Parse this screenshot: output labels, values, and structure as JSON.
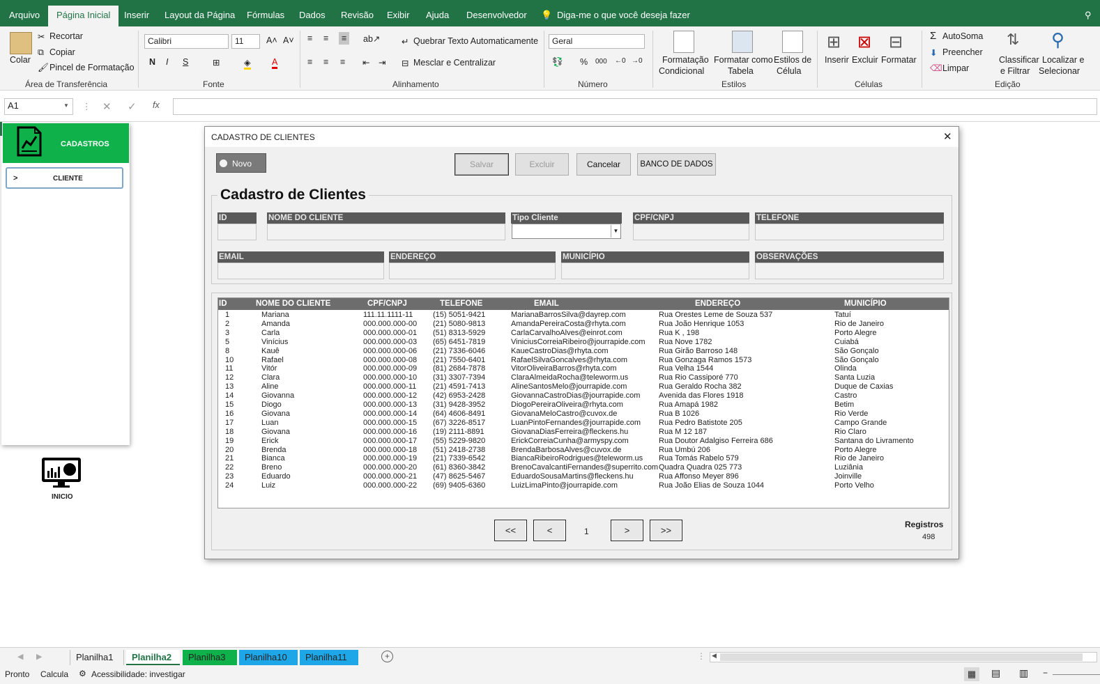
{
  "ribbon_tabs": [
    "Arquivo",
    "Página Inicial",
    "Inserir",
    "Layout da Página",
    "Fórmulas",
    "Dados",
    "Revisão",
    "Exibir",
    "Ajuda",
    "Desenvolvedor"
  ],
  "tell_me": "Diga-me o que você deseja fazer",
  "clipboard": {
    "paste": "Colar",
    "cut": "Recortar",
    "copy": "Copiar",
    "format_painter": "Pincel de Formatação",
    "group": "Área de Transferência"
  },
  "font": {
    "name": "Calibri",
    "size": "11",
    "bold": "N",
    "italic": "I",
    "underline": "S",
    "group": "Fonte"
  },
  "alignment": {
    "wrap": "Quebrar Texto Automaticamente",
    "merge": "Mesclar e Centralizar",
    "group": "Alinhamento"
  },
  "number": {
    "format": "Geral",
    "percent": "%",
    "thousands": "000",
    "group": "Número"
  },
  "styles": {
    "cond": "Formatação",
    "cond2": "Condicional",
    "table": "Formatar como",
    "table2": "Tabela",
    "cell": "Estilos de",
    "cell2": "Célula",
    "group": "Estilos"
  },
  "cells": {
    "insert": "Inserir",
    "delete": "Excluir",
    "format": "Formatar",
    "group": "Células"
  },
  "editing": {
    "autosum": "AutoSoma",
    "fill": "Preencher",
    "clear": "Limpar",
    "sort": "Classificar",
    "sort2": "e Filtrar",
    "find": "Localizar e",
    "find2": "Selecionar",
    "group": "Edição"
  },
  "formula_bar": {
    "name_box": "A1",
    "fx": "fx",
    "value": ""
  },
  "sidebar": {
    "header": "CADASTROS",
    "item_arrow": ">",
    "item": "CLIENTE",
    "home": "INICIO"
  },
  "dialog": {
    "title": "CADASTRO DE CLIENTES",
    "close": "✕",
    "buttons": {
      "novo": "Novo",
      "salvar": "Salvar",
      "excluir": "Excluir",
      "cancelar": "Cancelar",
      "banco": "BANCO DE DADOS"
    },
    "form_title": "Cadastro de Clientes",
    "fields": {
      "id": "ID",
      "nome": "NOME DO CLIENTE",
      "tipo": "Tipo Cliente",
      "cpf": "CPF/CNPJ",
      "telefone": "TELEFONE",
      "email": "EMAIL",
      "endereco": "ENDEREÇO",
      "municipio": "MUNICÍPIO",
      "obs": "OBSERVAÇÕES"
    },
    "list_headers": [
      "ID",
      "NOME DO CLIENTE",
      "CPF/CNPJ",
      "TELEFONE",
      "EMAIL",
      "ENDEREÇO",
      "MUNICÍPIO"
    ],
    "rows": [
      [
        "1",
        "Mariana",
        "111.11.1111-11",
        "(15) 5051-9421",
        "MarianaBarrosSilva@dayrep.com",
        "Rua Orestes Leme de Souza 537",
        "Tatuí"
      ],
      [
        "2",
        "Amanda",
        "000.000.000-00",
        "(21) 5080-9813",
        "AmandaPereiraCosta@rhyta.com",
        "Rua João Henrique 1053",
        "Rio de Janeiro"
      ],
      [
        "3",
        "Carla",
        "000.000.000-01",
        "(51) 8313-5929",
        "CarlaCarvalhoAlves@einrot.com",
        "Rua K , 198",
        "Porto Alegre"
      ],
      [
        "5",
        "Vinícius",
        "000.000.000-03",
        "(65) 6451-7819",
        "ViniciusCorreiaRibeiro@jourrapide.com",
        "Rua Nove 1782",
        "Cuiabá"
      ],
      [
        "8",
        "Kauê",
        "000.000.000-06",
        "(21) 7336-6046",
        "KaueCastroDias@rhyta.com",
        "Rua Girão Barroso 148",
        "São Gonçalo"
      ],
      [
        "10",
        "Rafael",
        "000.000.000-08",
        "(21) 7550-6401",
        "RafaelSilvaGoncalves@rhyta.com",
        "Rua Gonzaga Ramos 1573",
        "São Gonçalo"
      ],
      [
        "11",
        "Vitór",
        "000.000.000-09",
        "(81) 2684-7878",
        "VitorOliveiraBarros@rhyta.com",
        "Rua Velha 1544",
        "Olinda"
      ],
      [
        "12",
        "Clara",
        "000.000.000-10",
        "(31) 3307-7394",
        "ClaraAlmeidaRocha@teleworm.us",
        "Rua Rio Cassiporé 770",
        "Santa Luzia"
      ],
      [
        "13",
        "Aline",
        "000.000.000-11",
        "(21) 4591-7413",
        "AlineSantosMelo@jourrapide.com",
        "Rua Geraldo Rocha 382",
        "Duque de Caxias"
      ],
      [
        "14",
        "Giovanna",
        "000.000.000-12",
        "(42) 6953-2428",
        "GiovannaCastroDias@jourrapide.com",
        "Avenida das Flores 1918",
        "Castro"
      ],
      [
        "15",
        "Diogo",
        "000.000.000-13",
        "(31) 9428-3952",
        "DiogoPereiraOliveira@rhyta.com",
        "Rua Amapá 1982",
        "Betim"
      ],
      [
        "16",
        "Giovana",
        "000.000.000-14",
        "(64) 4606-8491",
        "GiovanaMeloCastro@cuvox.de",
        "Rua B 1026",
        "Rio Verde"
      ],
      [
        "17",
        "Luan",
        "000.000.000-15",
        "(67) 3226-8517",
        "LuanPintoFernandes@jourrapide.com",
        "Rua Pedro Batistote 205",
        "Campo Grande"
      ],
      [
        "18",
        "Giovana",
        "000.000.000-16",
        "(19) 2111-8891",
        "GiovanaDiasFerreira@fleckens.hu",
        "Rua M 12 187",
        "Rio Claro"
      ],
      [
        "19",
        "Erick",
        "000.000.000-17",
        "(55) 5229-9820",
        "ErickCorreiaCunha@armyspy.com",
        "Rua Doutor Adalgiso Ferreira 686",
        "Santana do Livramento"
      ],
      [
        "20",
        "Brenda",
        "000.000.000-18",
        "(51) 2418-2738",
        "BrendaBarbosaAlves@cuvox.de",
        "Rua Umbú 206",
        "Porto Alegre"
      ],
      [
        "21",
        "Bianca",
        "000.000.000-19",
        "(21) 7339-6542",
        "BiancaRibeiroRodrigues@teleworm.us",
        "Rua Tomás Rabelo 579",
        "Rio de Janeiro"
      ],
      [
        "22",
        "Breno",
        "000.000.000-20",
        "(61) 8360-3842",
        "BrenoCavalcantiFernandes@superrito.com",
        "Quadra Quadra 025 773",
        "Luziânia"
      ],
      [
        "23",
        "Eduardo",
        "000.000.000-21",
        "(47) 8625-5467",
        "EduardoSousaMartins@fleckens.hu",
        "Rua Affonso Meyer 896",
        "Joinville"
      ],
      [
        "24",
        "Luiz",
        "000.000.000-22",
        "(69) 9405-6360",
        "LuizLimaPinto@jourrapide.com",
        "Rua João Elias de Souza 1044",
        "Porto Velho"
      ]
    ],
    "pager": {
      "first": "<<",
      "prev": "<",
      "page": "1",
      "next": ">",
      "last": ">>"
    },
    "records_label": "Registros",
    "records_count": "498"
  },
  "sheet_tabs": [
    {
      "name": "Planilha1",
      "color": "#f3f3f3"
    },
    {
      "name": "Planilha2",
      "color": "#ffffff"
    },
    {
      "name": "Planilha3",
      "color": "#0eb14a"
    },
    {
      "name": "Planilha10",
      "color": "#1ea7e8"
    },
    {
      "name": "Planilha11",
      "color": "#1ea7e8"
    }
  ],
  "status": {
    "ready": "Pronto",
    "calc": "Calcula",
    "accessibility": "Acessibilidade: investigar"
  },
  "colors": {
    "excel_green": "#217346",
    "accent_green": "#0eb14a",
    "label_gray": "#595959"
  }
}
